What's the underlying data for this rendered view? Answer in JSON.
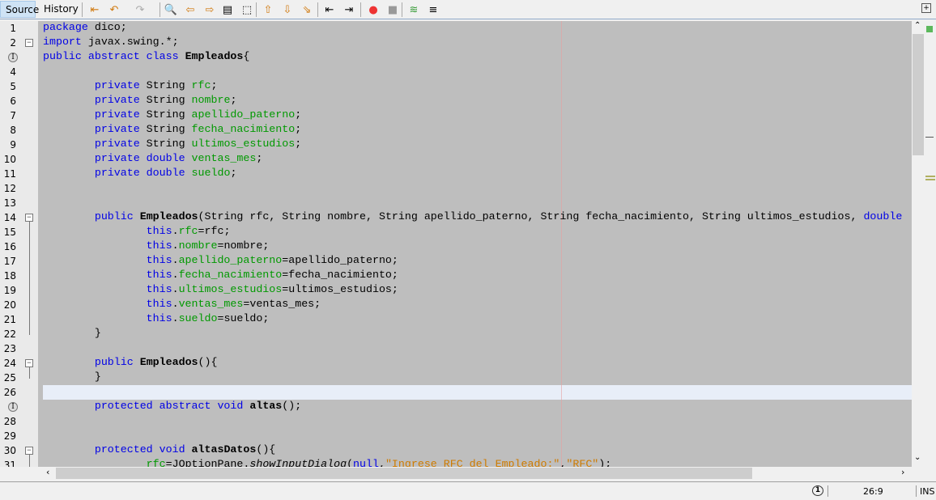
{
  "tabs": {
    "source": "Source",
    "history": "History"
  },
  "toolbar_icons": [
    "last-edit-icon",
    "back-icon",
    "forward-icon",
    "find-icon",
    "find-previous-icon",
    "find-next-icon",
    "toggle-highlight-icon",
    "toggle-rectangular-selection-icon",
    "previous-bookmark-icon",
    "next-bookmark-icon",
    "toggle-bookmark-icon",
    "shift-left-icon",
    "shift-right-icon",
    "start-macro-icon",
    "stop-macro-icon",
    "comment-icon",
    "uncomment-icon"
  ],
  "lines": [
    [
      [
        "k",
        "package"
      ],
      [
        "t",
        " dico;"
      ]
    ],
    [
      [
        "k",
        "import"
      ],
      [
        "t",
        " javax.swing.*;"
      ]
    ],
    [
      [
        "k",
        "public abstract class"
      ],
      [
        "t",
        " "
      ],
      [
        "m",
        "Empleados"
      ],
      [
        "t",
        "{"
      ]
    ],
    [],
    [
      [
        "t",
        "        "
      ],
      [
        "k",
        "private"
      ],
      [
        "t",
        " String "
      ],
      [
        "f",
        "rfc"
      ],
      [
        "t",
        ";"
      ]
    ],
    [
      [
        "t",
        "        "
      ],
      [
        "k",
        "private"
      ],
      [
        "t",
        " String "
      ],
      [
        "f",
        "nombre"
      ],
      [
        "t",
        ";"
      ]
    ],
    [
      [
        "t",
        "        "
      ],
      [
        "k",
        "private"
      ],
      [
        "t",
        " String "
      ],
      [
        "f",
        "apellido_paterno"
      ],
      [
        "t",
        ";"
      ]
    ],
    [
      [
        "t",
        "        "
      ],
      [
        "k",
        "private"
      ],
      [
        "t",
        " String "
      ],
      [
        "f",
        "fecha_nacimiento"
      ],
      [
        "t",
        ";"
      ]
    ],
    [
      [
        "t",
        "        "
      ],
      [
        "k",
        "private"
      ],
      [
        "t",
        " String "
      ],
      [
        "f",
        "ultimos_estudios"
      ],
      [
        "t",
        ";"
      ]
    ],
    [
      [
        "t",
        "        "
      ],
      [
        "k",
        "private double"
      ],
      [
        "t",
        " "
      ],
      [
        "f",
        "ventas_mes"
      ],
      [
        "t",
        ";"
      ]
    ],
    [
      [
        "t",
        "        "
      ],
      [
        "k",
        "private double"
      ],
      [
        "t",
        " "
      ],
      [
        "f",
        "sueldo"
      ],
      [
        "t",
        ";"
      ]
    ],
    [],
    [],
    [
      [
        "t",
        "        "
      ],
      [
        "k",
        "public"
      ],
      [
        "t",
        " "
      ],
      [
        "m",
        "Empleados"
      ],
      [
        "t",
        "(String rfc, String nombre, String apellido_paterno, String fecha_nacimiento, String ultimos_estudios, "
      ],
      [
        "k",
        "double"
      ]
    ],
    [
      [
        "t",
        "                "
      ],
      [
        "k",
        "this"
      ],
      [
        "t",
        "."
      ],
      [
        "f",
        "rfc"
      ],
      [
        "t",
        "=rfc;"
      ]
    ],
    [
      [
        "t",
        "                "
      ],
      [
        "k",
        "this"
      ],
      [
        "t",
        "."
      ],
      [
        "f",
        "nombre"
      ],
      [
        "t",
        "=nombre;"
      ]
    ],
    [
      [
        "t",
        "                "
      ],
      [
        "k",
        "this"
      ],
      [
        "t",
        "."
      ],
      [
        "f",
        "apellido_paterno"
      ],
      [
        "t",
        "=apellido_paterno;"
      ]
    ],
    [
      [
        "t",
        "                "
      ],
      [
        "k",
        "this"
      ],
      [
        "t",
        "."
      ],
      [
        "f",
        "fecha_nacimiento"
      ],
      [
        "t",
        "=fecha_nacimiento;"
      ]
    ],
    [
      [
        "t",
        "                "
      ],
      [
        "k",
        "this"
      ],
      [
        "t",
        "."
      ],
      [
        "f",
        "ultimos_estudios"
      ],
      [
        "t",
        "=ultimos_estudios;"
      ]
    ],
    [
      [
        "t",
        "                "
      ],
      [
        "k",
        "this"
      ],
      [
        "t",
        "."
      ],
      [
        "f",
        "ventas_mes"
      ],
      [
        "t",
        "=ventas_mes;"
      ]
    ],
    [
      [
        "t",
        "                "
      ],
      [
        "k",
        "this"
      ],
      [
        "t",
        "."
      ],
      [
        "f",
        "sueldo"
      ],
      [
        "t",
        "=sueldo;"
      ]
    ],
    [
      [
        "t",
        "        }"
      ]
    ],
    [],
    [
      [
        "t",
        "        "
      ],
      [
        "k",
        "public"
      ],
      [
        "t",
        " "
      ],
      [
        "m",
        "Empleados"
      ],
      [
        "t",
        "(){"
      ]
    ],
    [
      [
        "t",
        "        }"
      ]
    ],
    [],
    [
      [
        "t",
        "        "
      ],
      [
        "k",
        "protected abstract void"
      ],
      [
        "t",
        " "
      ],
      [
        "m",
        "altas"
      ],
      [
        "t",
        "();"
      ]
    ],
    [],
    [],
    [
      [
        "t",
        "        "
      ],
      [
        "k",
        "protected void"
      ],
      [
        "t",
        " "
      ],
      [
        "m",
        "altasDatos"
      ],
      [
        "t",
        "(){"
      ]
    ],
    [
      [
        "t",
        "                "
      ],
      [
        "f",
        "rfc"
      ],
      [
        "t",
        "=JOptionPane."
      ],
      [
        "i",
        "showInputDialog"
      ],
      [
        "t",
        "("
      ],
      [
        "k",
        "null"
      ],
      [
        "t",
        ","
      ],
      [
        "s",
        "\"Ingrese RFC del Empleado:\""
      ],
      [
        "t",
        ","
      ],
      [
        "s",
        "\"RFC\""
      ],
      [
        "t",
        ");"
      ]
    ]
  ],
  "line_numbers": [
    "1",
    "2",
    "",
    "4",
    "5",
    "6",
    "7",
    "8",
    "9",
    "10",
    "11",
    "12",
    "13",
    "14",
    "15",
    "16",
    "17",
    "18",
    "19",
    "20",
    "21",
    "22",
    "23",
    "24",
    "25",
    "26",
    "",
    "28",
    "29",
    "30",
    "31"
  ],
  "status": {
    "notifications": "1",
    "position": "26:9",
    "mode": "INS"
  }
}
